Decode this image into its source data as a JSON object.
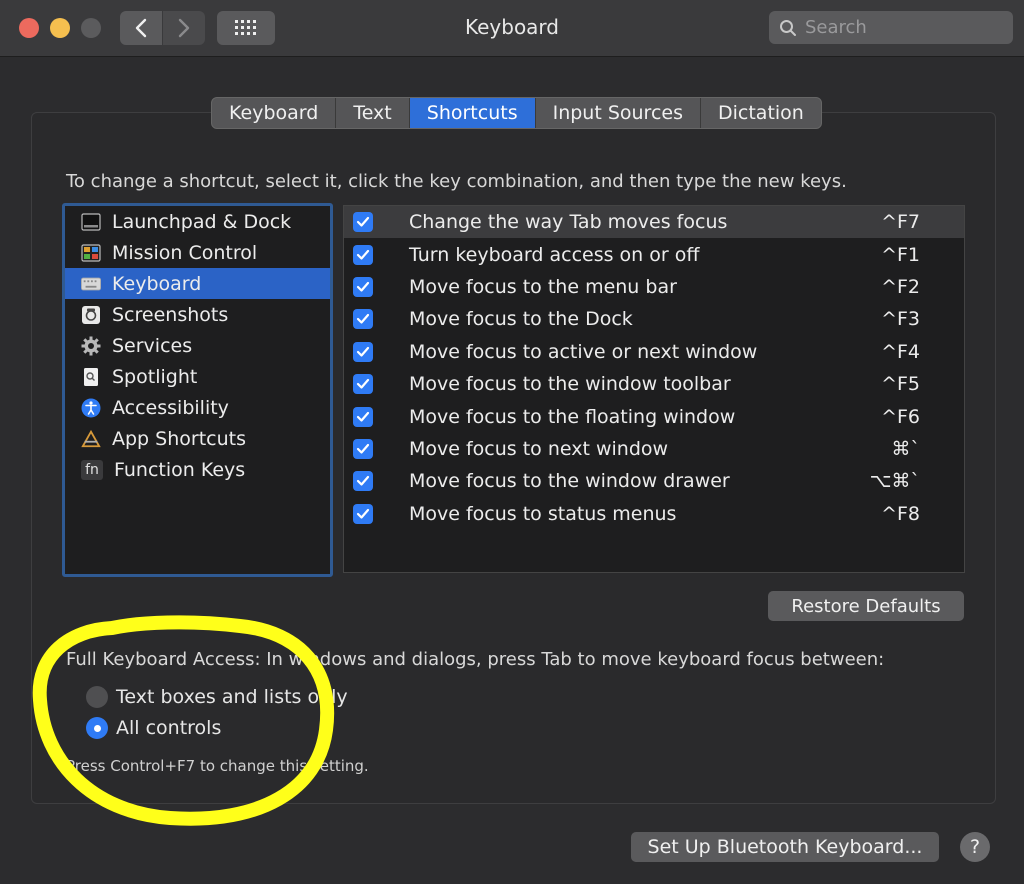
{
  "window": {
    "title": "Keyboard"
  },
  "search": {
    "placeholder": "Search"
  },
  "tabs": [
    {
      "label": "Keyboard",
      "active": false
    },
    {
      "label": "Text",
      "active": false
    },
    {
      "label": "Shortcuts",
      "active": true
    },
    {
      "label": "Input Sources",
      "active": false
    },
    {
      "label": "Dictation",
      "active": false
    }
  ],
  "instructions": "To change a shortcut, select it, click the key combination, and then type the new keys.",
  "sidebar": {
    "items": [
      {
        "label": "Launchpad & Dock",
        "icon": "launchpad-dock-icon",
        "selected": false
      },
      {
        "label": "Mission Control",
        "icon": "mission-control-icon",
        "selected": false
      },
      {
        "label": "Keyboard",
        "icon": "keyboard-icon",
        "selected": true
      },
      {
        "label": "Screenshots",
        "icon": "screenshot-icon",
        "selected": false
      },
      {
        "label": "Services",
        "icon": "gear-icon",
        "selected": false
      },
      {
        "label": "Spotlight",
        "icon": "spotlight-icon",
        "selected": false
      },
      {
        "label": "Accessibility",
        "icon": "accessibility-icon",
        "selected": false
      },
      {
        "label": "App Shortcuts",
        "icon": "app-shortcuts-icon",
        "selected": false
      },
      {
        "label": "Function Keys",
        "icon": "function-keys-icon",
        "icon_text": "fn",
        "selected": false
      }
    ]
  },
  "shortcuts": [
    {
      "label": "Change the way Tab moves focus",
      "key": "^F7",
      "checked": true
    },
    {
      "label": "Turn keyboard access on or off",
      "key": "^F1",
      "checked": true
    },
    {
      "label": "Move focus to the menu bar",
      "key": "^F2",
      "checked": true
    },
    {
      "label": "Move focus to the Dock",
      "key": "^F3",
      "checked": true
    },
    {
      "label": "Move focus to active or next window",
      "key": "^F4",
      "checked": true
    },
    {
      "label": "Move focus to the window toolbar",
      "key": "^F5",
      "checked": true
    },
    {
      "label": "Move focus to the floating window",
      "key": "^F6",
      "checked": true
    },
    {
      "label": "Move focus to next window",
      "key": "⌘`",
      "checked": true
    },
    {
      "label": "Move focus to the window drawer",
      "key": "⌥⌘`",
      "checked": true
    },
    {
      "label": "Move focus to status menus",
      "key": "^F8",
      "checked": true
    }
  ],
  "restore_label": "Restore Defaults",
  "full_keyboard_access": {
    "text": "Full Keyboard Access: In windows and dialogs, press Tab to move keyboard focus between:",
    "options": [
      {
        "label": "Text boxes and lists only",
        "selected": false
      },
      {
        "label": "All controls",
        "selected": true
      }
    ],
    "hint": "Press Control+F7 to change this setting."
  },
  "bluetooth_label": "Set Up Bluetooth Keyboard...",
  "help_label": "?",
  "colors": {
    "accent": "#2f7bf5",
    "annotation": "#ffff1a"
  }
}
